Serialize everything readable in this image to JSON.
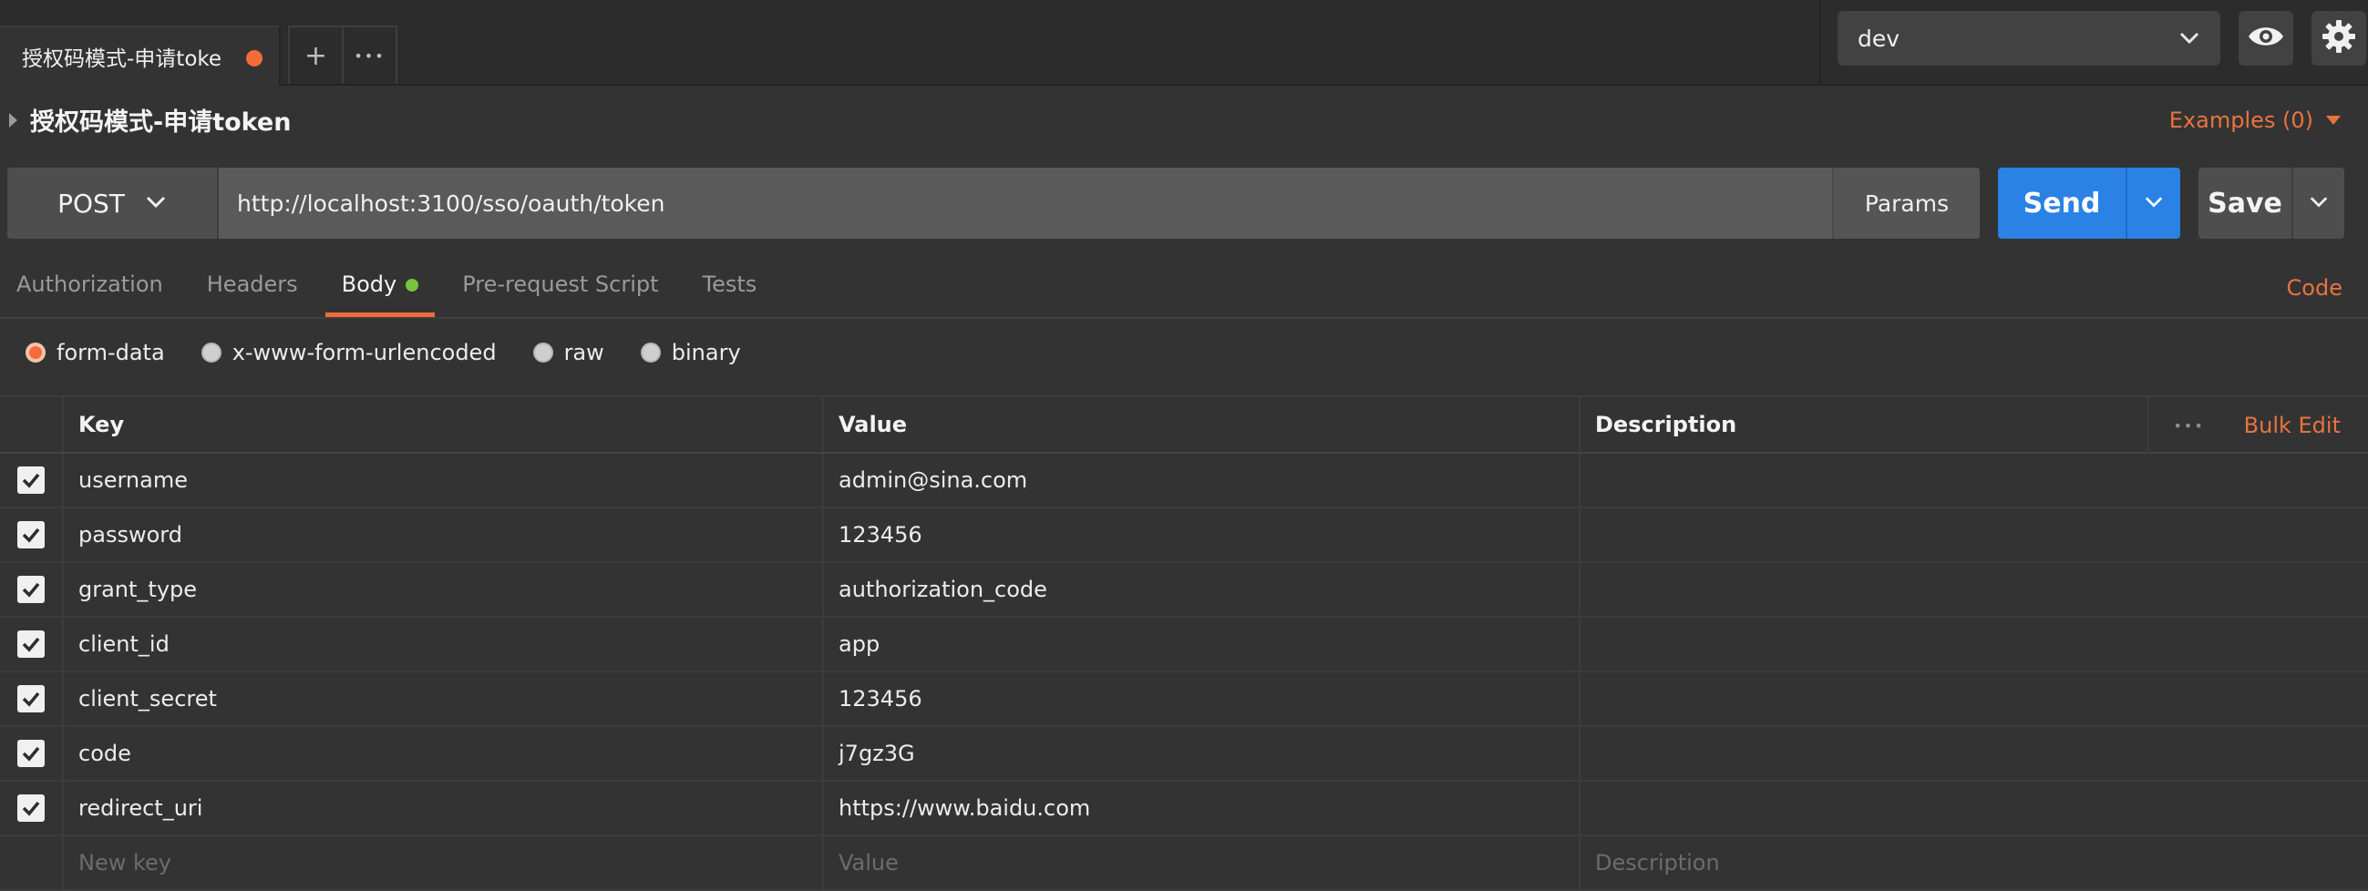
{
  "tabs": {
    "active_tab_label": "授权码模式-申请toke",
    "add_label": "+",
    "more_label": "•••"
  },
  "environment": {
    "selected": "dev"
  },
  "request": {
    "title": "授权码模式-申请token",
    "examples_label": "Examples (0)",
    "method": "POST",
    "url": "http://localhost:3100/sso/oauth/token",
    "params_label": "Params",
    "send_label": "Send",
    "save_label": "Save"
  },
  "subtabs": [
    {
      "label": "Authorization"
    },
    {
      "label": "Headers"
    },
    {
      "label": "Body"
    },
    {
      "label": "Pre-request Script"
    },
    {
      "label": "Tests"
    }
  ],
  "code_label": "Code",
  "body_types": [
    {
      "label": "form-data",
      "selected": true
    },
    {
      "label": "x-www-form-urlencoded",
      "selected": false
    },
    {
      "label": "raw",
      "selected": false
    },
    {
      "label": "binary",
      "selected": false
    }
  ],
  "table": {
    "headers": {
      "key": "Key",
      "value": "Value",
      "description": "Description"
    },
    "more_label": "•••",
    "bulk_edit_label": "Bulk Edit",
    "rows": [
      {
        "key": "username",
        "value": "admin@sina.com",
        "description": "",
        "checked": true
      },
      {
        "key": "password",
        "value": "123456",
        "description": "",
        "checked": true
      },
      {
        "key": "grant_type",
        "value": "authorization_code",
        "description": "",
        "checked": true
      },
      {
        "key": "client_id",
        "value": "app",
        "description": "",
        "checked": true
      },
      {
        "key": "client_secret",
        "value": "123456",
        "description": "",
        "checked": true
      },
      {
        "key": "code",
        "value": "j7gz3G",
        "description": "",
        "checked": true
      },
      {
        "key": "redirect_uri",
        "value": "https://www.baidu.com",
        "description": "",
        "checked": true
      }
    ],
    "new_row": {
      "key_placeholder": "New key",
      "value_placeholder": "Value",
      "description_placeholder": "Description"
    }
  },
  "colors": {
    "accent_orange": "#f26b3a",
    "send_blue": "#2a82e4",
    "body_dot_green": "#78c23c"
  }
}
